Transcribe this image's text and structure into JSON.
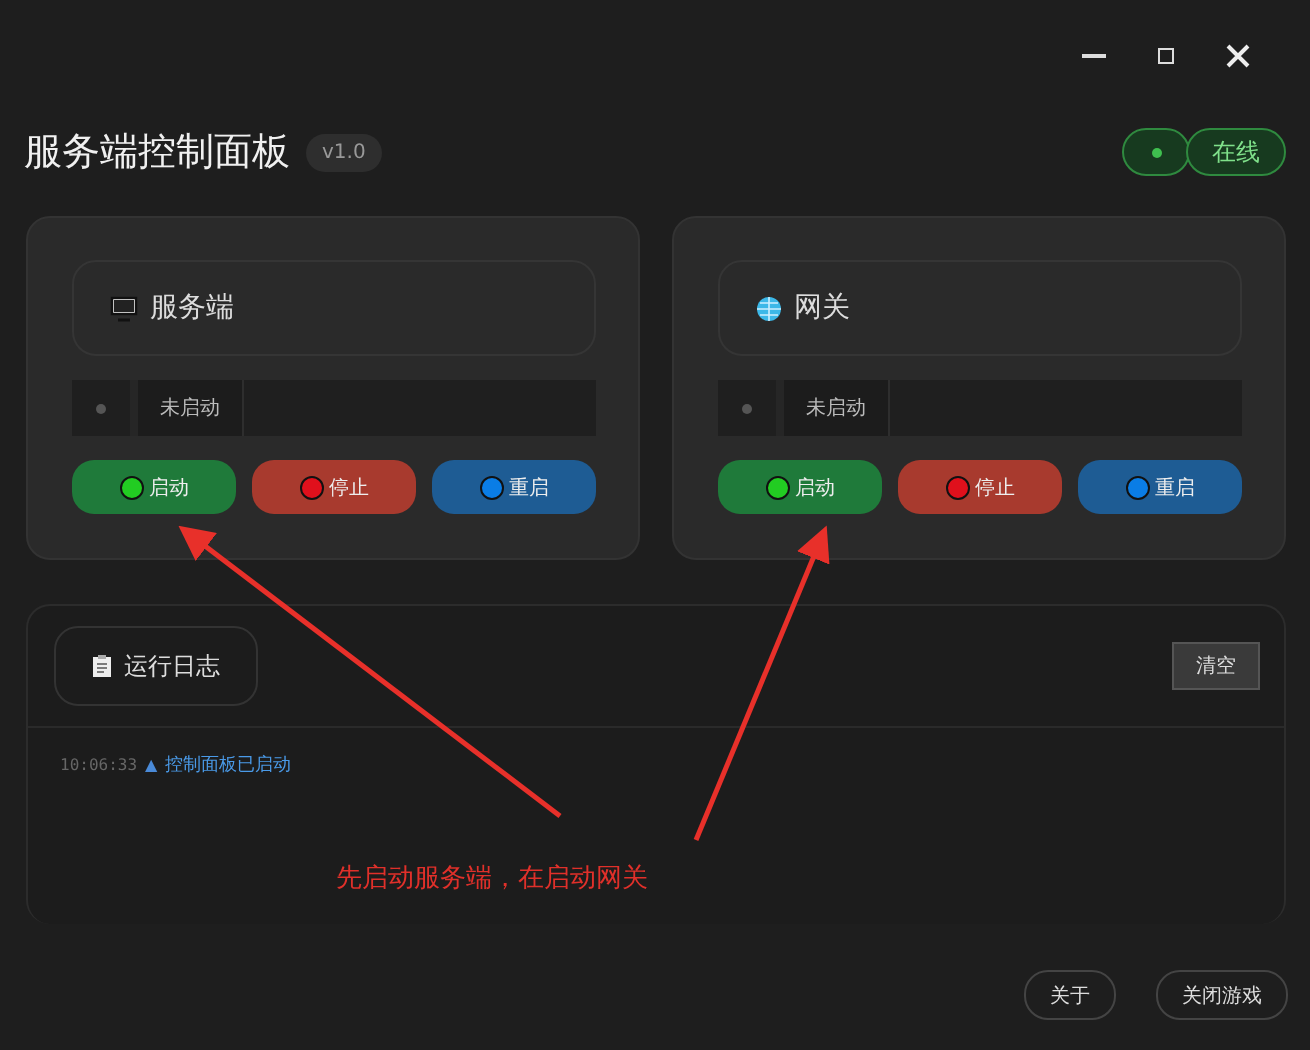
{
  "header": {
    "title": "服务端控制面板",
    "version": "v1.0",
    "status": {
      "label": "在线",
      "online": true
    }
  },
  "cards": [
    {
      "kind": "server",
      "title": "服务端",
      "status": "未启动",
      "running": false,
      "buttons": [
        {
          "kind": "start",
          "label": "启动"
        },
        {
          "kind": "stop",
          "label": "停止"
        },
        {
          "kind": "restart",
          "label": "重启"
        }
      ]
    },
    {
      "kind": "gateway",
      "title": "网关",
      "status": "未启动",
      "running": false,
      "buttons": [
        {
          "kind": "start",
          "label": "启动"
        },
        {
          "kind": "stop",
          "label": "停止"
        },
        {
          "kind": "restart",
          "label": "重启"
        }
      ]
    }
  ],
  "log": {
    "title": "运行日志",
    "clear_button": "清空",
    "entries": [
      {
        "time": "10:06:33",
        "marker": "▲",
        "text": "控制面板已启动"
      }
    ]
  },
  "annotation": {
    "text": "先启动服务端，在启动网关"
  },
  "footer_buttons": [
    "关于",
    "关闭游戏"
  ]
}
